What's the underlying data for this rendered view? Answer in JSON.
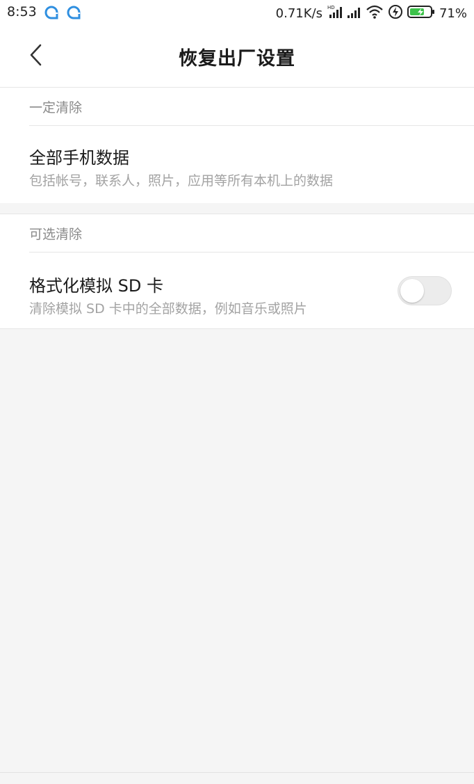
{
  "status_bar": {
    "time": "8:53",
    "app_icons": [
      "browser-icon",
      "browser-icon"
    ],
    "network_speed": "0.71K/s",
    "hd_badge": "HD",
    "battery_percent": "71%",
    "battery_level": 0.71,
    "battery_color": "#3cc24a"
  },
  "header": {
    "back_icon": "chevron-left-icon",
    "title": "恢复出厂设置"
  },
  "sections": [
    {
      "header": "一定清除",
      "items": [
        {
          "title": "全部手机数据",
          "subtitle": "包括帐号，联系人，照片，应用等所有本机上的数据"
        }
      ]
    },
    {
      "header": "可选清除",
      "items": [
        {
          "title": "格式化模拟 SD 卡",
          "subtitle": "清除模拟 SD 卡中的全部数据，例如音乐或照片",
          "toggle_on": false
        }
      ]
    }
  ],
  "colors": {
    "background": "#f5f5f5",
    "card": "#ffffff",
    "title_text": "#1a1a1a",
    "secondary_text": "#a3a3a3",
    "toggle_off": "#ececec"
  }
}
